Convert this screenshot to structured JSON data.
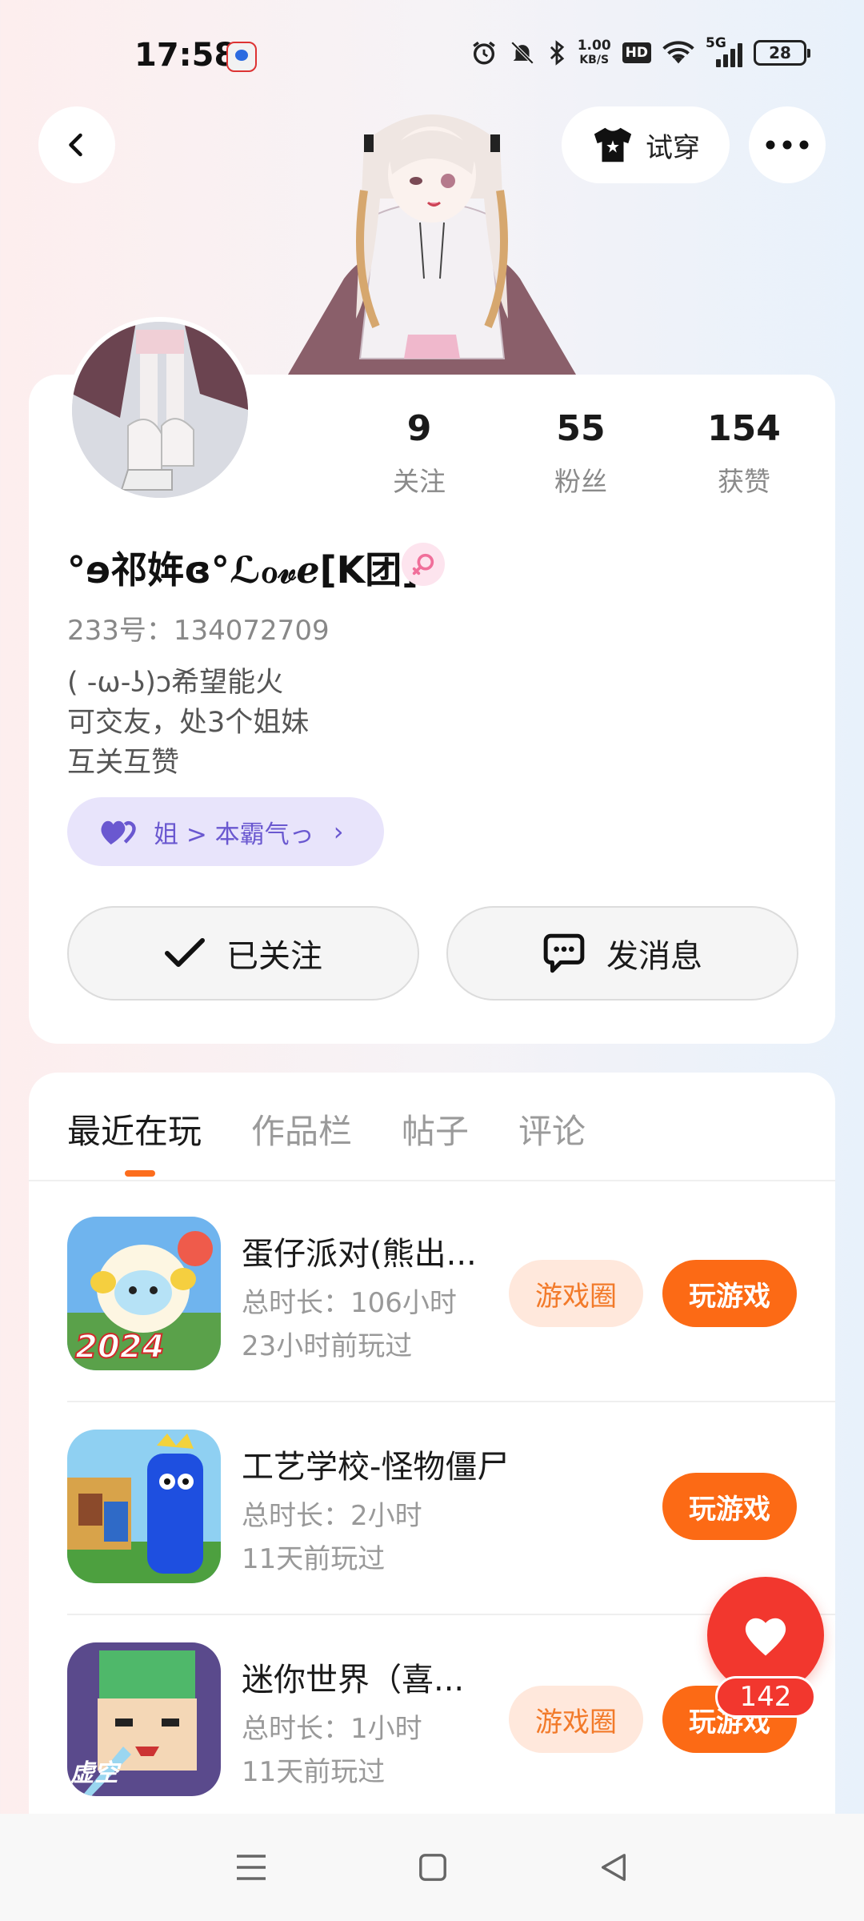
{
  "status_bar": {
    "time": "17:58",
    "speed_value": "1.00",
    "speed_unit": "KB/S",
    "hd": "HD",
    "network": "5G",
    "battery": "28"
  },
  "header": {
    "try_on_label": "试穿"
  },
  "profile": {
    "stats": [
      {
        "value": "9",
        "label": "关注"
      },
      {
        "value": "55",
        "label": "粉丝"
      },
      {
        "value": "154",
        "label": "获赞"
      }
    ],
    "nickname": "°ɘ祁姩ɞ°ℒℴ𝓋ℯ[K团]",
    "uid": "233号：134072709",
    "bio": [
      "( -ω-ʖ)ↄ希望能火",
      "可交友，处3个姐妹",
      "互关互赞"
    ],
    "relation": "姐 > 本霸气っ",
    "follow_label": "已关注",
    "message_label": "发消息",
    "colors": {
      "accent": "#fc6a15",
      "relation": "#6a58d0",
      "gender": "#f06f9a"
    }
  },
  "tabs": [
    "最近在玩",
    "作品栏",
    "帖子",
    "评论"
  ],
  "games": [
    {
      "name": "蛋仔派对(熊出...",
      "duration": "总时长：106小时",
      "last_played": "23小时前玩过",
      "circle_label": "游戏圈",
      "play_label": "玩游戏",
      "badge": "2024"
    },
    {
      "name": "工艺学校-怪物僵尸",
      "duration": "总时长：2小时",
      "last_played": "11天前玩过",
      "play_label": "玩游戏"
    },
    {
      "name": "迷你世界（喜...",
      "duration": "总时长：1小时",
      "last_played": "11天前玩过",
      "circle_label": "游戏圈",
      "play_label": "玩游戏",
      "badge": "虚空"
    }
  ],
  "like": {
    "count": "142"
  }
}
